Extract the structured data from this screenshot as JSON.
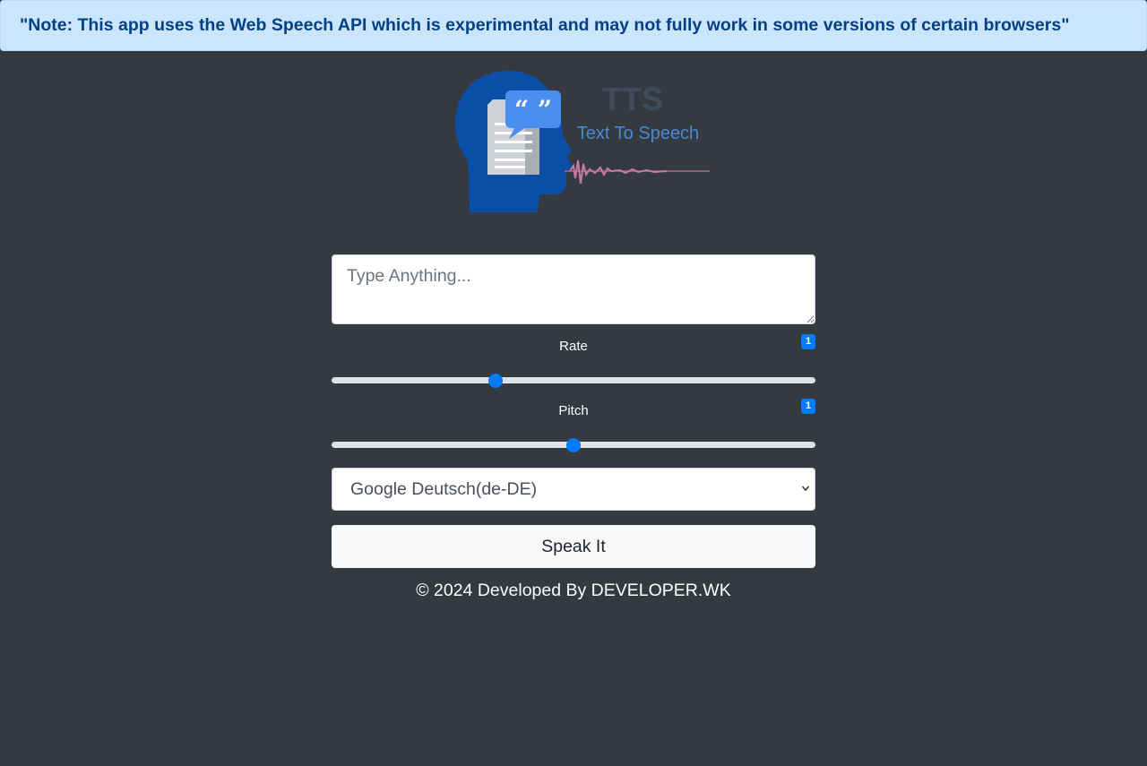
{
  "alert": {
    "note_text": "\"Note: This app uses the Web Speech API which is experimental and may not fully work in some versions of certain browsers\""
  },
  "logo": {
    "title": "TTS",
    "subtitle": "Text To Speech",
    "quote_glyph": "“ ”"
  },
  "form": {
    "text_placeholder": "Type Anything...",
    "rate": {
      "label": "Rate",
      "value": "1",
      "min": 0.5,
      "max": 2,
      "current": 1
    },
    "pitch": {
      "label": "Pitch",
      "value": "1",
      "min": 0,
      "max": 2,
      "current": 1
    },
    "voice_select": {
      "selected": "Google Deutsch(de-DE)"
    },
    "speak_button": "Speak It"
  },
  "footer": {
    "text": "© 2024 Developed By DEVELOPER.WK"
  },
  "colors": {
    "background": "#343a40",
    "alert_bg": "#cce5ff",
    "alert_text": "#004085",
    "accent": "#007bff",
    "logo_blue": "#0d47a1"
  }
}
